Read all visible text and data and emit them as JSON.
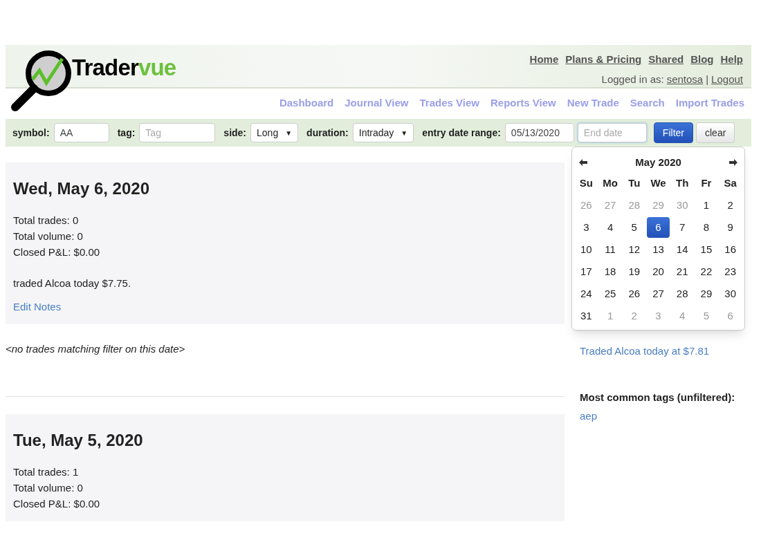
{
  "logo": {
    "text_dark": "Trader",
    "text_green": "vue"
  },
  "top_links": [
    "Home",
    "Plans & Pricing",
    "Shared",
    "Blog",
    "Help"
  ],
  "login": {
    "prefix": "Logged in as:",
    "user": "sentosa",
    "separator": "|",
    "logout": "Logout"
  },
  "nav": [
    "Dashboard",
    "Journal View",
    "Trades View",
    "Reports View",
    "New Trade",
    "Search",
    "Import Trades"
  ],
  "filter": {
    "fields": [
      {
        "kind": "text",
        "label": "symbol:",
        "value": "AA"
      },
      {
        "kind": "text",
        "label": "tag:",
        "placeholder": "Tag"
      },
      {
        "kind": "select",
        "label": "side:",
        "value": "Long",
        "arrow": "▼"
      },
      {
        "kind": "select",
        "label": "duration:",
        "value": "Intraday",
        "arrow": "▼"
      },
      {
        "kind": "range",
        "label": "entry date range:",
        "value": "05/13/2020",
        "placeholder": "End date"
      }
    ],
    "buttons": [
      {
        "label": "Filter",
        "primary": true
      },
      {
        "label": "clear",
        "primary": false
      }
    ]
  },
  "days": [
    {
      "title": "Wed, May 6, 2020",
      "stats": [
        "Total trades: 0",
        "Total volume: 0",
        "Closed P&L: $0.00"
      ],
      "note": "traded Alcoa today $7.75.",
      "edit_link": "Edit Notes",
      "empty_message": "<no trades matching filter on this date>"
    },
    {
      "title": "Tue, May 5, 2020",
      "stats": [
        "Total trades: 1",
        "Total volume: 0",
        "Closed P&L: $0.00"
      ]
    }
  ],
  "sidebar": {
    "link": "Traded Alcoa today at $7.81",
    "tags_heading": "Most common tags (unfiltered):",
    "tags": [
      "aep"
    ]
  },
  "calendar": {
    "title": "May 2020",
    "weekdays": [
      "Su",
      "Mo",
      "Tu",
      "We",
      "Th",
      "Fr",
      "Sa"
    ],
    "days": [
      {
        "day": "26",
        "muted": true,
        "selected": false
      },
      {
        "day": "27",
        "muted": true,
        "selected": false
      },
      {
        "day": "28",
        "muted": true,
        "selected": false
      },
      {
        "day": "29",
        "muted": true,
        "selected": false
      },
      {
        "day": "30",
        "muted": true,
        "selected": false
      },
      {
        "day": "1",
        "muted": false,
        "selected": false
      },
      {
        "day": "2",
        "muted": false,
        "selected": false
      },
      {
        "day": "3",
        "muted": false,
        "selected": false
      },
      {
        "day": "4",
        "muted": false,
        "selected": false
      },
      {
        "day": "5",
        "muted": false,
        "selected": false
      },
      {
        "day": "6",
        "muted": false,
        "selected": true
      },
      {
        "day": "7",
        "muted": false,
        "selected": false
      },
      {
        "day": "8",
        "muted": false,
        "selected": false
      },
      {
        "day": "9",
        "muted": false,
        "selected": false
      },
      {
        "day": "10",
        "muted": false,
        "selected": false
      },
      {
        "day": "11",
        "muted": false,
        "selected": false
      },
      {
        "day": "12",
        "muted": false,
        "selected": false
      },
      {
        "day": "13",
        "muted": false,
        "selected": false
      },
      {
        "day": "14",
        "muted": false,
        "selected": false
      },
      {
        "day": "15",
        "muted": false,
        "selected": false
      },
      {
        "day": "16",
        "muted": false,
        "selected": false
      },
      {
        "day": "17",
        "muted": false,
        "selected": false
      },
      {
        "day": "18",
        "muted": false,
        "selected": false
      },
      {
        "day": "19",
        "muted": false,
        "selected": false
      },
      {
        "day": "20",
        "muted": false,
        "selected": false
      },
      {
        "day": "21",
        "muted": false,
        "selected": false
      },
      {
        "day": "22",
        "muted": false,
        "selected": false
      },
      {
        "day": "23",
        "muted": false,
        "selected": false
      },
      {
        "day": "24",
        "muted": false,
        "selected": false
      },
      {
        "day": "25",
        "muted": false,
        "selected": false
      },
      {
        "day": "26",
        "muted": false,
        "selected": false
      },
      {
        "day": "27",
        "muted": false,
        "selected": false
      },
      {
        "day": "28",
        "muted": false,
        "selected": false
      },
      {
        "day": "29",
        "muted": false,
        "selected": false
      },
      {
        "day": "30",
        "muted": false,
        "selected": false
      },
      {
        "day": "31",
        "muted": false,
        "selected": false
      },
      {
        "day": "1",
        "muted": true,
        "selected": false
      },
      {
        "day": "2",
        "muted": true,
        "selected": false
      },
      {
        "day": "3",
        "muted": true,
        "selected": false
      },
      {
        "day": "4",
        "muted": true,
        "selected": false
      },
      {
        "day": "5",
        "muted": true,
        "selected": false
      },
      {
        "day": "6",
        "muted": true,
        "selected": false
      }
    ]
  }
}
